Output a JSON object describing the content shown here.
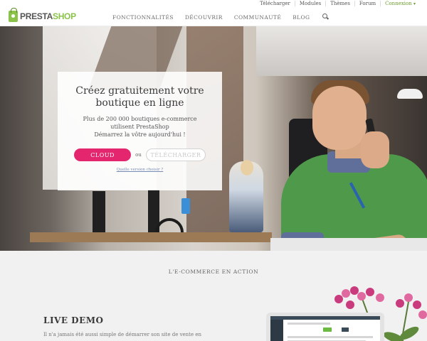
{
  "toplinks": {
    "download": "Télécharger",
    "modules": "Modules",
    "themes": "Thèmes",
    "forum": "Forum",
    "connect": "Connexion"
  },
  "logo": {
    "part1": "PRESTA",
    "part2": "SHOP"
  },
  "nav": {
    "features": "FONCTIONNALITÉS",
    "discover": "DÉCOUVRIR",
    "community": "COMMUNAUTÉ",
    "blog": "BLOG"
  },
  "hero": {
    "title": "Créez gratuitement votre boutique en ligne",
    "subtitle_line1": "Plus de 200 000 boutiques e-commerce",
    "subtitle_line2": "utilisent PrestaShop",
    "subtitle_line3": "Démarrez la vôtre aujourd'hui !",
    "cloud_button": "CLOUD",
    "or_text": "ou",
    "download_button": "TÉLÉCHARGER",
    "which_version": "Quelle version choisir ?"
  },
  "section": {
    "title": "L'E-COMMERCE EN ACTION",
    "live_demo_title": "LIVE DEMO",
    "live_demo_text": "Il n'a jamais été aussi simple de démarrer son site de vente en"
  },
  "colors": {
    "brand_green": "#8bc34a",
    "cloud_pink": "#e3266e",
    "connect_green": "#6c9e2e"
  }
}
